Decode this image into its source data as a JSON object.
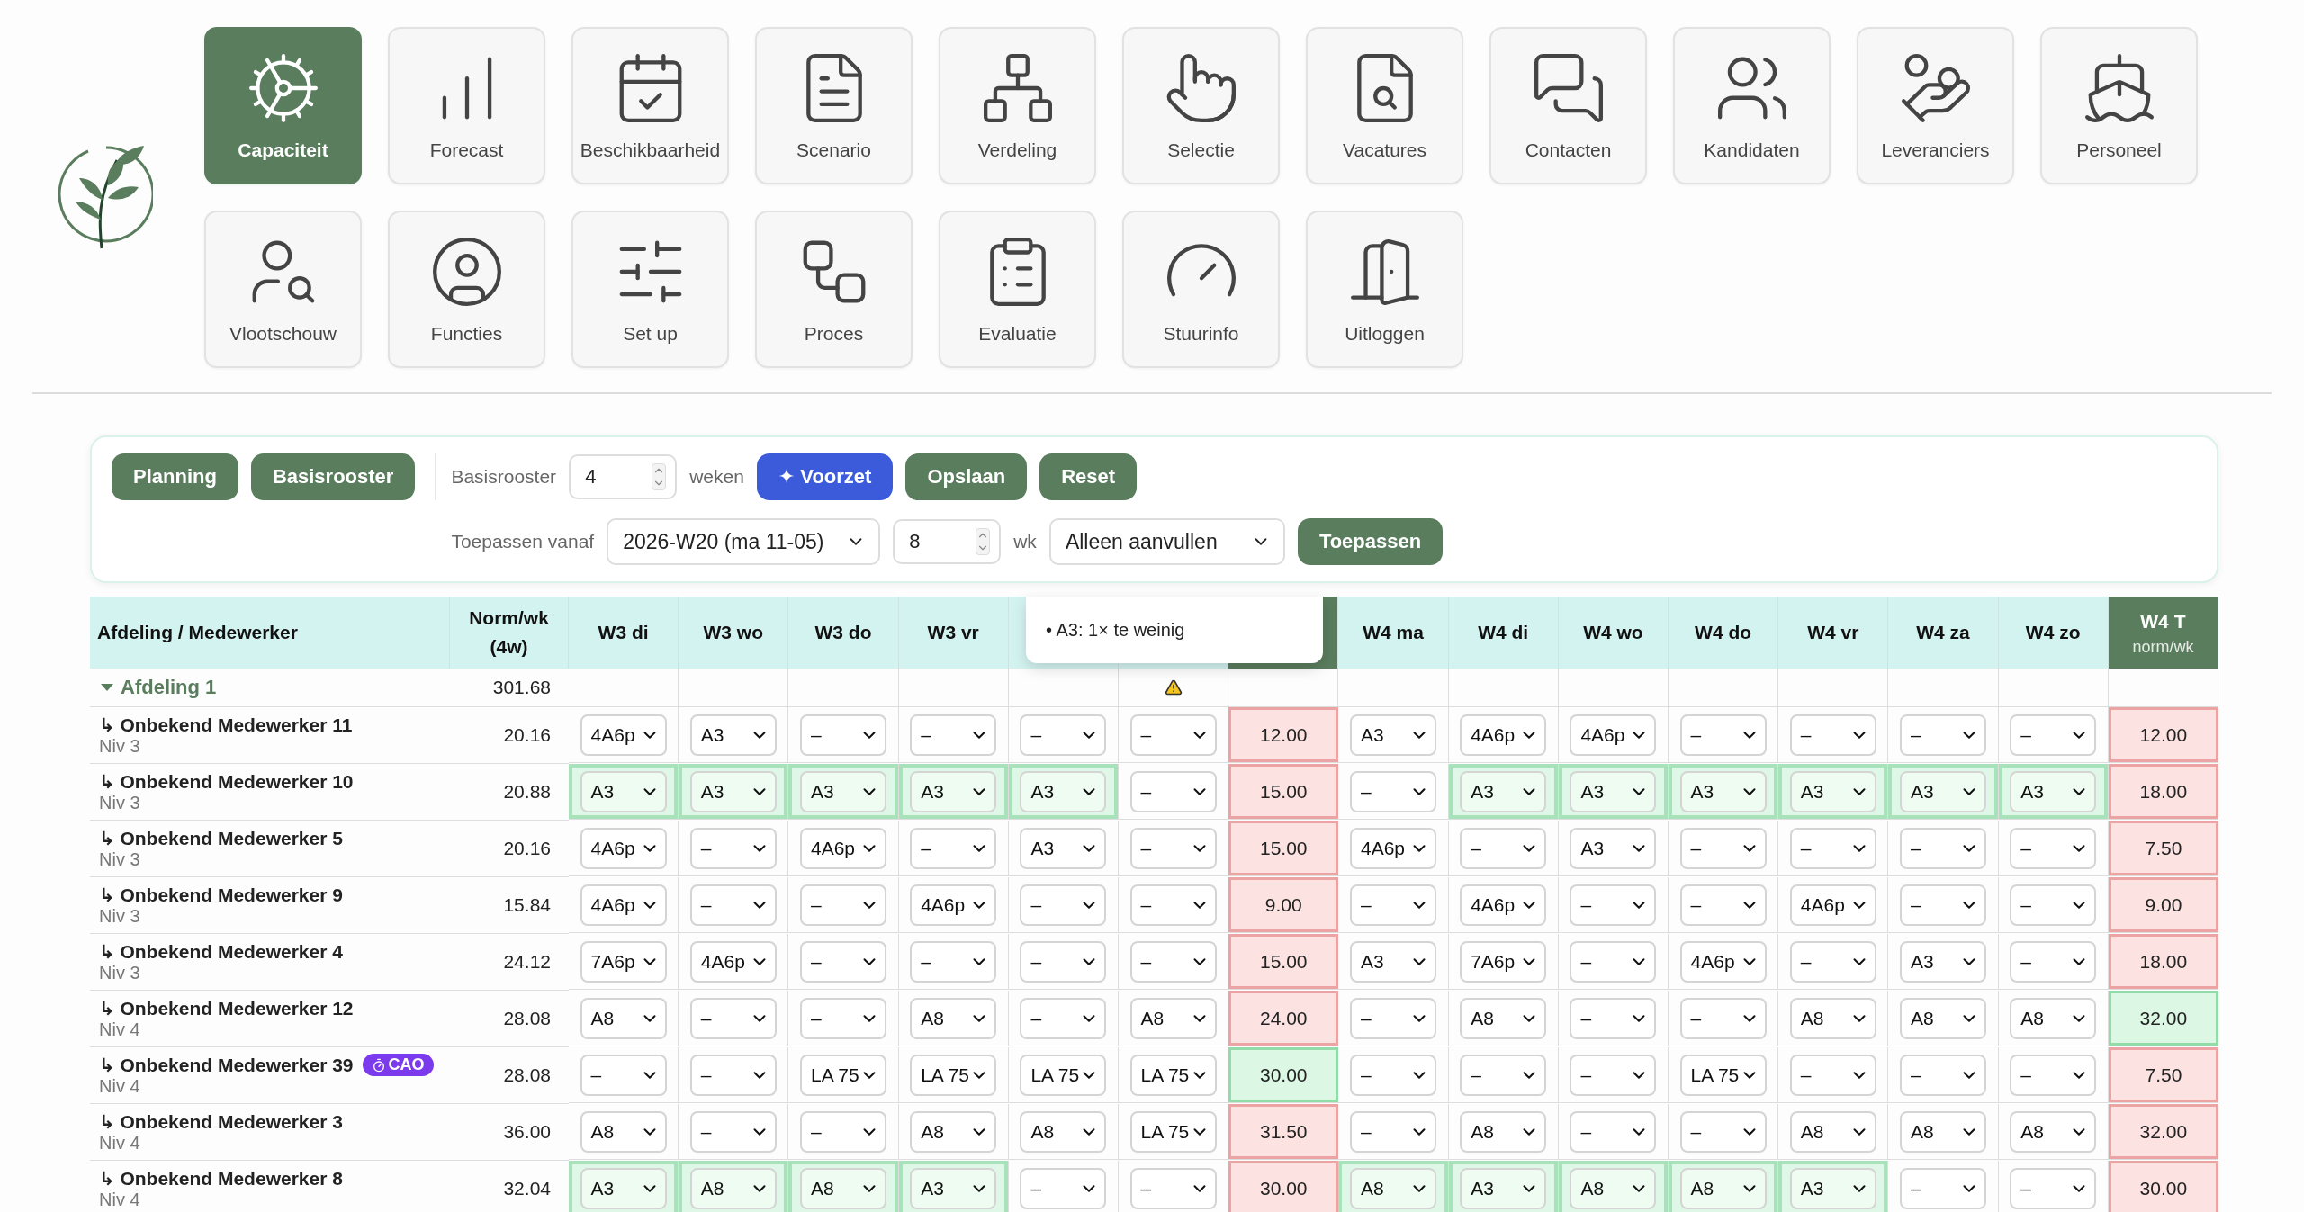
{
  "nav": [
    {
      "label": "Capaciteit",
      "selected": true
    },
    {
      "label": "Forecast",
      "selected": false
    },
    {
      "label": "Beschikbaarheid",
      "selected": false
    },
    {
      "label": "Scenario",
      "selected": false
    },
    {
      "label": "Verdeling",
      "selected": false
    },
    {
      "label": "Selectie",
      "selected": false
    },
    {
      "label": "Vacatures",
      "selected": false
    },
    {
      "label": "Contacten",
      "selected": false
    },
    {
      "label": "Kandidaten",
      "selected": false
    },
    {
      "label": "Leveranciers",
      "selected": false
    },
    {
      "label": "Personeel",
      "selected": false
    },
    {
      "label": "Vlootschouw",
      "selected": false
    },
    {
      "label": "Functies",
      "selected": false
    },
    {
      "label": "Set up",
      "selected": false
    },
    {
      "label": "Proces",
      "selected": false
    },
    {
      "label": "Evaluatie",
      "selected": false
    },
    {
      "label": "Stuurinfo",
      "selected": false
    },
    {
      "label": "Uitloggen",
      "selected": false
    }
  ],
  "toolbar": {
    "view_buttons": [
      "Planning",
      "Basisrooster"
    ],
    "basis_label": "Basisrooster",
    "basis_value": "4",
    "basis_unit": "weken",
    "voorzet": "✦ Voorzet",
    "save": "Opslaan",
    "reset": "Reset",
    "apply_label": "Toepassen vanaf",
    "apply_from": "2026-W20 (ma 11-05)",
    "weeks_value": "8",
    "weeks_unit": "wk",
    "mode": "Alleen aanvullen",
    "apply": "Toepassen"
  },
  "tooltip": {
    "lines": [
      "• A3: 1× te weinig"
    ]
  },
  "table": {
    "name_header": "Afdeling / Medewerker",
    "norm_header": "Norm/wk (4w)",
    "columns": [
      {
        "kind": "day",
        "label": "W3 di"
      },
      {
        "kind": "day",
        "label": "W3 wo"
      },
      {
        "kind": "day",
        "label": "W3 do"
      },
      {
        "kind": "day",
        "label": "W3 vr"
      },
      {
        "kind": "day"
      },
      {
        "kind": "day"
      },
      {
        "kind": "total"
      },
      {
        "kind": "day",
        "label": "W4 ma"
      },
      {
        "kind": "day",
        "label": "W4 di"
      },
      {
        "kind": "day",
        "label": "W4 wo"
      },
      {
        "kind": "day",
        "label": "W4 do"
      },
      {
        "kind": "day",
        "label": "W4 vr"
      },
      {
        "kind": "day",
        "label": "W4 za"
      },
      {
        "kind": "day",
        "label": "W4 zo"
      },
      {
        "kind": "total",
        "label": "W4 T",
        "sub": "norm/wk"
      }
    ],
    "group": {
      "name": "Afdeling 1",
      "expanded": true,
      "norm": "301.68",
      "warnings": [
        false,
        false,
        false,
        false,
        false,
        true,
        false,
        false,
        false,
        false,
        false,
        false,
        false,
        false,
        false
      ]
    },
    "rows": [
      {
        "name": "↳ Onbekend Medewerker 11",
        "level": "Niv 3",
        "norm": "20.16",
        "cells": [
          {
            "kind": "shift",
            "value": "4A6p",
            "highlighted": false
          },
          {
            "kind": "shift",
            "value": "A3",
            "highlighted": false
          },
          {
            "kind": "shift",
            "value": "–",
            "highlighted": false
          },
          {
            "kind": "shift",
            "value": "–",
            "highlighted": false
          },
          {
            "kind": "shift",
            "value": "–",
            "highlighted": false
          },
          {
            "kind": "shift",
            "value": "–",
            "highlighted": false
          },
          {
            "kind": "total",
            "value": "12.00",
            "ok": false
          },
          {
            "kind": "shift",
            "value": "A3",
            "highlighted": false
          },
          {
            "kind": "shift",
            "value": "4A6p",
            "highlighted": false
          },
          {
            "kind": "shift",
            "value": "4A6p",
            "highlighted": false
          },
          {
            "kind": "shift",
            "value": "–",
            "highlighted": false
          },
          {
            "kind": "shift",
            "value": "–",
            "highlighted": false
          },
          {
            "kind": "shift",
            "value": "–",
            "highlighted": false
          },
          {
            "kind": "shift",
            "value": "–",
            "highlighted": false
          },
          {
            "kind": "total",
            "value": "12.00",
            "ok": false
          }
        ]
      },
      {
        "name": "↳ Onbekend Medewerker 10",
        "level": "Niv 3",
        "norm": "20.88",
        "cells": [
          {
            "kind": "shift",
            "value": "A3",
            "highlighted": true
          },
          {
            "kind": "shift",
            "value": "A3",
            "highlighted": true
          },
          {
            "kind": "shift",
            "value": "A3",
            "highlighted": true
          },
          {
            "kind": "shift",
            "value": "A3",
            "highlighted": true
          },
          {
            "kind": "shift",
            "value": "A3",
            "highlighted": true
          },
          {
            "kind": "shift",
            "value": "–",
            "highlighted": false
          },
          {
            "kind": "total",
            "value": "15.00",
            "ok": false
          },
          {
            "kind": "shift",
            "value": "–",
            "highlighted": false
          },
          {
            "kind": "shift",
            "value": "A3",
            "highlighted": true
          },
          {
            "kind": "shift",
            "value": "A3",
            "highlighted": true
          },
          {
            "kind": "shift",
            "value": "A3",
            "highlighted": true
          },
          {
            "kind": "shift",
            "value": "A3",
            "highlighted": true
          },
          {
            "kind": "shift",
            "value": "A3",
            "highlighted": true
          },
          {
            "kind": "shift",
            "value": "A3",
            "highlighted": true
          },
          {
            "kind": "total",
            "value": "18.00",
            "ok": false
          }
        ]
      },
      {
        "name": "↳ Onbekend Medewerker 5",
        "level": "Niv 3",
        "norm": "20.16",
        "cells": [
          {
            "kind": "shift",
            "value": "4A6p",
            "highlighted": false
          },
          {
            "kind": "shift",
            "value": "–",
            "highlighted": false
          },
          {
            "kind": "shift",
            "value": "4A6p",
            "highlighted": false
          },
          {
            "kind": "shift",
            "value": "–",
            "highlighted": false
          },
          {
            "kind": "shift",
            "value": "A3",
            "highlighted": false
          },
          {
            "kind": "shift",
            "value": "–",
            "highlighted": false
          },
          {
            "kind": "total",
            "value": "15.00",
            "ok": false
          },
          {
            "kind": "shift",
            "value": "4A6p",
            "highlighted": false
          },
          {
            "kind": "shift",
            "value": "–",
            "highlighted": false
          },
          {
            "kind": "shift",
            "value": "A3",
            "highlighted": false
          },
          {
            "kind": "shift",
            "value": "–",
            "highlighted": false
          },
          {
            "kind": "shift",
            "value": "–",
            "highlighted": false
          },
          {
            "kind": "shift",
            "value": "–",
            "highlighted": false
          },
          {
            "kind": "shift",
            "value": "–",
            "highlighted": false
          },
          {
            "kind": "total",
            "value": "7.50",
            "ok": false
          }
        ]
      },
      {
        "name": "↳ Onbekend Medewerker 9",
        "level": "Niv 3",
        "norm": "15.84",
        "cells": [
          {
            "kind": "shift",
            "value": "4A6p",
            "highlighted": false
          },
          {
            "kind": "shift",
            "value": "–",
            "highlighted": false
          },
          {
            "kind": "shift",
            "value": "–",
            "highlighted": false
          },
          {
            "kind": "shift",
            "value": "4A6p",
            "highlighted": false
          },
          {
            "kind": "shift",
            "value": "–",
            "highlighted": false
          },
          {
            "kind": "shift",
            "value": "–",
            "highlighted": false
          },
          {
            "kind": "total",
            "value": "9.00",
            "ok": false
          },
          {
            "kind": "shift",
            "value": "–",
            "highlighted": false
          },
          {
            "kind": "shift",
            "value": "4A6p",
            "highlighted": false
          },
          {
            "kind": "shift",
            "value": "–",
            "highlighted": false
          },
          {
            "kind": "shift",
            "value": "–",
            "highlighted": false
          },
          {
            "kind": "shift",
            "value": "4A6p",
            "highlighted": false
          },
          {
            "kind": "shift",
            "value": "–",
            "highlighted": false
          },
          {
            "kind": "shift",
            "value": "–",
            "highlighted": false
          },
          {
            "kind": "total",
            "value": "9.00",
            "ok": false
          }
        ]
      },
      {
        "name": "↳ Onbekend Medewerker 4",
        "level": "Niv 3",
        "norm": "24.12",
        "cells": [
          {
            "kind": "shift",
            "value": "7A6p",
            "highlighted": false
          },
          {
            "kind": "shift",
            "value": "4A6p",
            "highlighted": false
          },
          {
            "kind": "shift",
            "value": "–",
            "highlighted": false
          },
          {
            "kind": "shift",
            "value": "–",
            "highlighted": false
          },
          {
            "kind": "shift",
            "value": "–",
            "highlighted": false
          },
          {
            "kind": "shift",
            "value": "–",
            "highlighted": false
          },
          {
            "kind": "total",
            "value": "15.00",
            "ok": false
          },
          {
            "kind": "shift",
            "value": "A3",
            "highlighted": false
          },
          {
            "kind": "shift",
            "value": "7A6p",
            "highlighted": false
          },
          {
            "kind": "shift",
            "value": "–",
            "highlighted": false
          },
          {
            "kind": "shift",
            "value": "4A6p",
            "highlighted": false
          },
          {
            "kind": "shift",
            "value": "–",
            "highlighted": false
          },
          {
            "kind": "shift",
            "value": "A3",
            "highlighted": false
          },
          {
            "kind": "shift",
            "value": "–",
            "highlighted": false
          },
          {
            "kind": "total",
            "value": "18.00",
            "ok": false
          }
        ]
      },
      {
        "name": "↳ Onbekend Medewerker 12",
        "level": "Niv 4",
        "norm": "28.08",
        "cells": [
          {
            "kind": "shift",
            "value": "A8",
            "highlighted": false
          },
          {
            "kind": "shift",
            "value": "–",
            "highlighted": false
          },
          {
            "kind": "shift",
            "value": "–",
            "highlighted": false
          },
          {
            "kind": "shift",
            "value": "A8",
            "highlighted": false
          },
          {
            "kind": "shift",
            "value": "–",
            "highlighted": false
          },
          {
            "kind": "shift",
            "value": "A8",
            "highlighted": false
          },
          {
            "kind": "total",
            "value": "24.00",
            "ok": false
          },
          {
            "kind": "shift",
            "value": "–",
            "highlighted": false
          },
          {
            "kind": "shift",
            "value": "A8",
            "highlighted": false
          },
          {
            "kind": "shift",
            "value": "–",
            "highlighted": false
          },
          {
            "kind": "shift",
            "value": "–",
            "highlighted": false
          },
          {
            "kind": "shift",
            "value": "A8",
            "highlighted": false
          },
          {
            "kind": "shift",
            "value": "A8",
            "highlighted": false
          },
          {
            "kind": "shift",
            "value": "A8",
            "highlighted": false
          },
          {
            "kind": "total",
            "value": "32.00",
            "ok": true
          }
        ]
      },
      {
        "name": "↳ Onbekend Medewerker 39",
        "badge": "CAO",
        "level": "Niv 4",
        "norm": "28.08",
        "cells": [
          {
            "kind": "shift",
            "value": "–",
            "highlighted": false
          },
          {
            "kind": "shift",
            "value": "–",
            "highlighted": false
          },
          {
            "kind": "shift",
            "value": "LA 75",
            "highlighted": false
          },
          {
            "kind": "shift",
            "value": "LA 75",
            "highlighted": false
          },
          {
            "kind": "shift",
            "value": "LA 75",
            "highlighted": false
          },
          {
            "kind": "shift",
            "value": "LA 75",
            "highlighted": false
          },
          {
            "kind": "total",
            "value": "30.00",
            "ok": true
          },
          {
            "kind": "shift",
            "value": "–",
            "highlighted": false
          },
          {
            "kind": "shift",
            "value": "–",
            "highlighted": false
          },
          {
            "kind": "shift",
            "value": "–",
            "highlighted": false
          },
          {
            "kind": "shift",
            "value": "LA 75",
            "highlighted": false
          },
          {
            "kind": "shift",
            "value": "–",
            "highlighted": false
          },
          {
            "kind": "shift",
            "value": "–",
            "highlighted": false
          },
          {
            "kind": "shift",
            "value": "–",
            "highlighted": false
          },
          {
            "kind": "total",
            "value": "7.50",
            "ok": false
          }
        ]
      },
      {
        "name": "↳ Onbekend Medewerker 3",
        "level": "Niv 4",
        "norm": "36.00",
        "cells": [
          {
            "kind": "shift",
            "value": "A8",
            "highlighted": false
          },
          {
            "kind": "shift",
            "value": "–",
            "highlighted": false
          },
          {
            "kind": "shift",
            "value": "–",
            "highlighted": false
          },
          {
            "kind": "shift",
            "value": "A8",
            "highlighted": false
          },
          {
            "kind": "shift",
            "value": "A8",
            "highlighted": false
          },
          {
            "kind": "shift",
            "value": "LA 75",
            "highlighted": false
          },
          {
            "kind": "total",
            "value": "31.50",
            "ok": false
          },
          {
            "kind": "shift",
            "value": "–",
            "highlighted": false
          },
          {
            "kind": "shift",
            "value": "A8",
            "highlighted": false
          },
          {
            "kind": "shift",
            "value": "–",
            "highlighted": false
          },
          {
            "kind": "shift",
            "value": "–",
            "highlighted": false
          },
          {
            "kind": "shift",
            "value": "A8",
            "highlighted": false
          },
          {
            "kind": "shift",
            "value": "A8",
            "highlighted": false
          },
          {
            "kind": "shift",
            "value": "A8",
            "highlighted": false
          },
          {
            "kind": "total",
            "value": "32.00",
            "ok": false
          }
        ]
      },
      {
        "name": "↳ Onbekend Medewerker 8",
        "level": "Niv 4",
        "norm": "32.04",
        "cells": [
          {
            "kind": "shift",
            "value": "A3",
            "highlighted": true
          },
          {
            "kind": "shift",
            "value": "A8",
            "highlighted": true
          },
          {
            "kind": "shift",
            "value": "A8",
            "highlighted": true
          },
          {
            "kind": "shift",
            "value": "A3",
            "highlighted": true
          },
          {
            "kind": "shift",
            "value": "–",
            "highlighted": false
          },
          {
            "kind": "shift",
            "value": "–",
            "highlighted": false
          },
          {
            "kind": "total",
            "value": "30.00",
            "ok": false
          },
          {
            "kind": "shift",
            "value": "A8",
            "highlighted": true
          },
          {
            "kind": "shift",
            "value": "A3",
            "highlighted": true
          },
          {
            "kind": "shift",
            "value": "A8",
            "highlighted": true
          },
          {
            "kind": "shift",
            "value": "A8",
            "highlighted": true
          },
          {
            "kind": "shift",
            "value": "A3",
            "highlighted": true
          },
          {
            "kind": "shift",
            "value": "–",
            "highlighted": false
          },
          {
            "kind": "shift",
            "value": "–",
            "highlighted": false
          },
          {
            "kind": "total",
            "value": "30.00",
            "ok": false
          }
        ]
      }
    ]
  }
}
